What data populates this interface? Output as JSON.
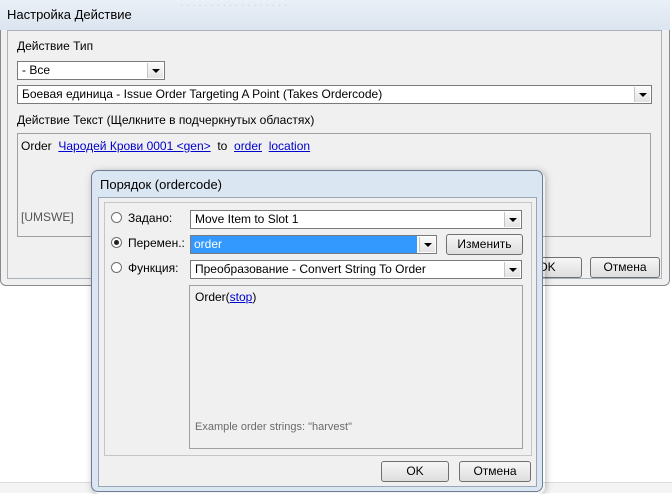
{
  "outer_dialog": {
    "title": "Настройка Действие",
    "faint_background_text": "· · · · · · · · · · · · · · · · · ·",
    "type_label": "Действие Тип",
    "category_value": "- Все",
    "action_value": "Боевая единица - Issue Order Targeting A Point (Takes Ordercode)",
    "text_label": "Действие Текст (Щелкните в подчеркнутых областях)",
    "action_text": {
      "prefix": "Order",
      "unit_link": "Чародей Крови 0001 <gen>",
      "to_word": "to",
      "order_link": "order",
      "location_link": "location"
    },
    "tag": "[UMSWE]",
    "ok_label": "OK",
    "cancel_label": "Отмена"
  },
  "inner_dialog": {
    "title": "Порядок (ordercode)",
    "preset_label": "Задано:",
    "preset_value": "Move Item to Slot 1",
    "variable_label": "Перемен.:",
    "variable_value": "order",
    "edit_button": "Изменить",
    "function_label": "Функция:",
    "function_value": "Преобразование - Convert String To Order",
    "function_text": {
      "prefix": "Order(",
      "link": "stop",
      "suffix": ")"
    },
    "example_text": "Example order strings:  \"harvest\"",
    "ok_label": "OK",
    "cancel_label": "Отмена",
    "selected_option": "variable"
  },
  "colors": {
    "selection": "#3399ff",
    "link": "#0000cc",
    "titlebar": "#dbe6f3"
  }
}
